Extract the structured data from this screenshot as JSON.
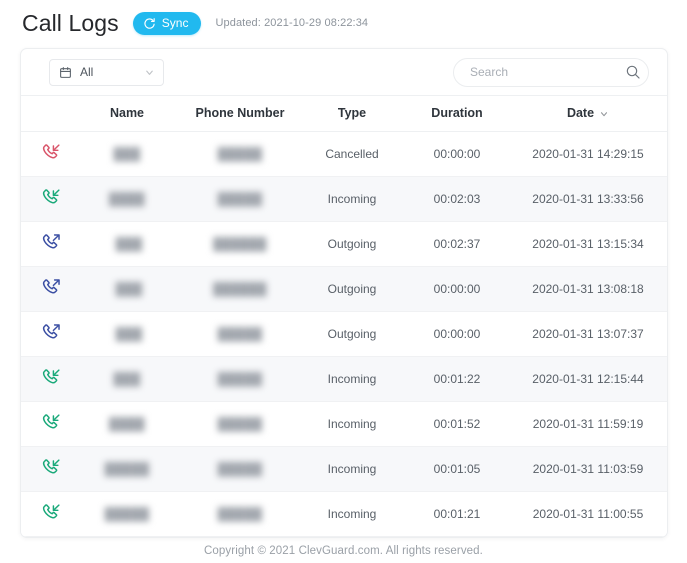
{
  "header": {
    "title": "Call Logs",
    "sync_label": "Sync",
    "sync_icon": "refresh-icon",
    "updated_text": "Updated: 2021-10-29 08:22:34",
    "accent_color": "#21b9ef"
  },
  "toolbar": {
    "filter": {
      "icon": "calendar-icon",
      "value": "All",
      "chevron_icon": "chevron-down-icon"
    },
    "search": {
      "value": "",
      "placeholder": "Search",
      "icon": "search-icon"
    }
  },
  "table": {
    "columns": [
      {
        "key": "icon",
        "label": ""
      },
      {
        "key": "name",
        "label": "Name"
      },
      {
        "key": "phone",
        "label": "Phone Number"
      },
      {
        "key": "type",
        "label": "Type"
      },
      {
        "key": "duration",
        "label": "Duration"
      },
      {
        "key": "date",
        "label": "Date"
      }
    ],
    "sorted_column": "Date",
    "sort_icon": "chevron-down-icon",
    "rows": [
      {
        "icon": "call-missed-icon",
        "icon_color": "#d9556a",
        "name": "",
        "phone": "",
        "type": "Cancelled",
        "duration": "00:00:00",
        "date": "2020-01-31 14:29:15"
      },
      {
        "icon": "call-incoming-icon",
        "icon_color": "#1aa97a",
        "name": "",
        "phone": "",
        "type": "Incoming",
        "duration": "00:02:03",
        "date": "2020-01-31 13:33:56"
      },
      {
        "icon": "call-outgoing-icon",
        "icon_color": "#3b4fa3",
        "name": "",
        "phone": "",
        "type": "Outgoing",
        "duration": "00:02:37",
        "date": "2020-01-31 13:15:34"
      },
      {
        "icon": "call-outgoing-icon",
        "icon_color": "#3b4fa3",
        "name": "",
        "phone": "",
        "type": "Outgoing",
        "duration": "00:00:00",
        "date": "2020-01-31 13:08:18"
      },
      {
        "icon": "call-outgoing-icon",
        "icon_color": "#3b4fa3",
        "name": "",
        "phone": "",
        "type": "Outgoing",
        "duration": "00:00:00",
        "date": "2020-01-31 13:07:37"
      },
      {
        "icon": "call-incoming-icon",
        "icon_color": "#1aa97a",
        "name": "",
        "phone": "",
        "type": "Incoming",
        "duration": "00:01:22",
        "date": "2020-01-31 12:15:44"
      },
      {
        "icon": "call-incoming-icon",
        "icon_color": "#1aa97a",
        "name": "",
        "phone": "",
        "type": "Incoming",
        "duration": "00:01:52",
        "date": "2020-01-31 11:59:19"
      },
      {
        "icon": "call-incoming-icon",
        "icon_color": "#1aa97a",
        "name": "",
        "phone": "",
        "type": "Incoming",
        "duration": "00:01:05",
        "date": "2020-01-31 11:03:59"
      },
      {
        "icon": "call-incoming-icon",
        "icon_color": "#1aa97a",
        "name": "",
        "phone": "",
        "type": "Incoming",
        "duration": "00:01:21",
        "date": "2020-01-31 11:00:55"
      }
    ]
  },
  "footer": {
    "copyright": "Copyright © 2021 ClevGuard.com. All rights reserved."
  }
}
